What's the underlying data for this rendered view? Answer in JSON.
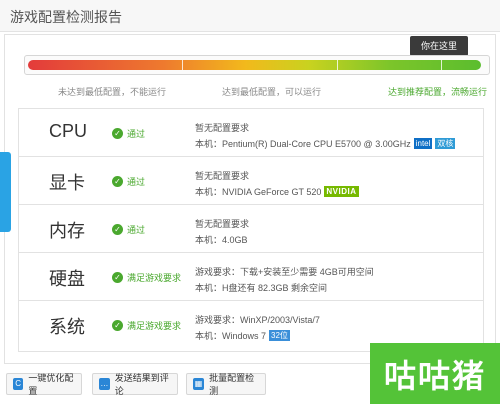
{
  "header": {
    "title": "游戏配置检测报告"
  },
  "meter": {
    "tooltip": "你在这里",
    "fill_fraction": 0.99,
    "labels": [
      "未达到最低配置，不能运行",
      "达到最低配置，可以运行",
      "达到推荐配置，流畅运行"
    ]
  },
  "rows": [
    {
      "name": "CPU",
      "status": "通过",
      "requirement": "暂无配置要求",
      "local": "本机：Pentium(R) Dual-Core CPU E5700 @ 3.00GHz",
      "badges": [
        "intel",
        "双核"
      ]
    },
    {
      "name": "显卡",
      "status": "通过",
      "requirement": "暂无配置要求",
      "local": "本机：NVIDIA GeForce GT 520",
      "badges": [
        "NVIDIA"
      ]
    },
    {
      "name": "内存",
      "status": "通过",
      "requirement": "暂无配置要求",
      "local": "本机：4.0GB",
      "badges": []
    },
    {
      "name": "硬盘",
      "status": "满足游戏要求",
      "requirement": "游戏要求：下载+安装至少需要 4GB可用空间",
      "local": "本机：H盘还有 82.3GB 剩余空间",
      "badges": []
    },
    {
      "name": "系统",
      "status": "满足游戏要求",
      "requirement": "游戏要求：WinXP/2003/Vista/7",
      "local": "本机：Windows 7",
      "badges": [
        "32位"
      ]
    }
  ],
  "footer": {
    "optimize": "一键优化配置",
    "send": "发送结果到评论",
    "batch": "批量配置检测"
  },
  "watermark": "咕咕猪",
  "colors": {
    "pass_green": "#4aa82e",
    "accent_blue": "#2a86d6",
    "logo_green": "#54c338"
  }
}
